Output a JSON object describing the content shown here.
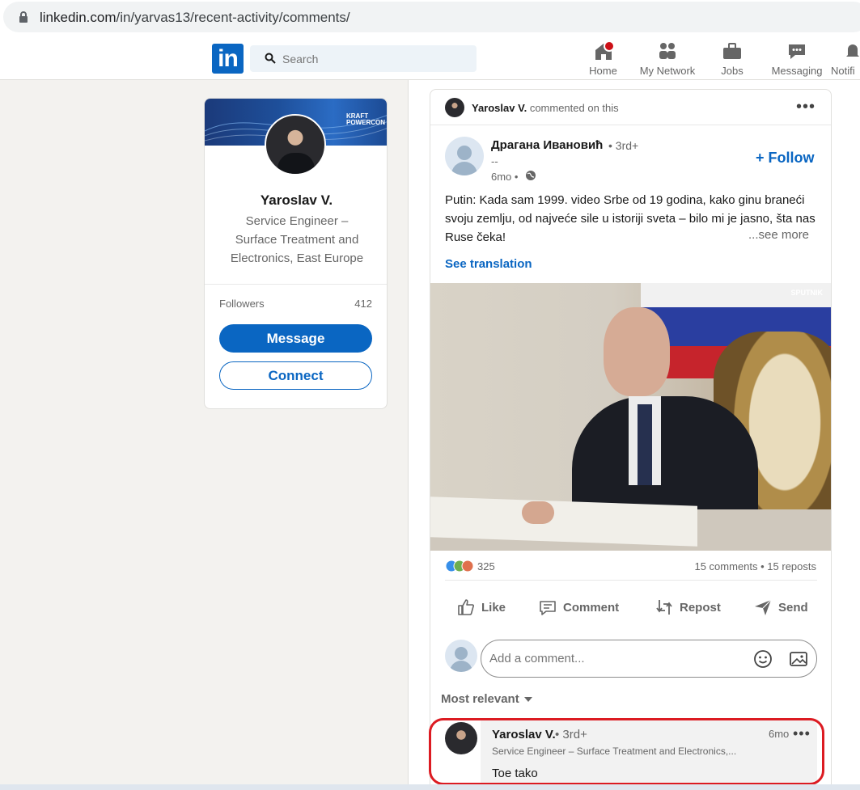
{
  "browser": {
    "url_host": "linkedin.com",
    "url_path": "/in/yarvas13/recent-activity/comments/"
  },
  "nav": {
    "logo": "in",
    "search_placeholder": "Search",
    "items": [
      {
        "label": "Home",
        "icon": "home-icon"
      },
      {
        "label": "My Network",
        "icon": "network-icon"
      },
      {
        "label": "Jobs",
        "icon": "briefcase-icon"
      },
      {
        "label": "Messaging",
        "icon": "messaging-icon"
      },
      {
        "label": "Notifi",
        "icon": "bell-icon"
      }
    ]
  },
  "profile": {
    "banner_brand": "KRAFT POWERCON",
    "name": "Yaroslav V.",
    "title": "Service Engineer – Surface Treatment and Electronics, East Europe",
    "followers_label": "Followers",
    "followers_count": "412",
    "message_label": "Message",
    "connect_label": "Connect"
  },
  "post": {
    "activity_actor": "Yaroslav V.",
    "activity_text": "commented on this",
    "author_name": "Драгана Ивановић",
    "author_degree": "• 3rd+",
    "author_sub": "--",
    "time": "6mo •",
    "follow_label": "+ Follow",
    "text": "Putin: Kada sam 1999. video Srbe od 19 godina, kako ginu braneći svoju zemlju, od najveće sile u istoriji sveta – bilo mi je jasno, šta nas Ruse čeka!",
    "see_more": "...see more",
    "see_translation": "See translation",
    "image_watermark": "SPUTNIK",
    "reactions_count": "325",
    "stats": "15 comments • 15 reposts",
    "actions": {
      "like": "Like",
      "comment": "Comment",
      "repost": "Repost",
      "send": "Send"
    },
    "comment_placeholder": "Add a comment...",
    "sort_label": "Most relevant"
  },
  "comment": {
    "name": "Yaroslav V.",
    "degree": "• 3rd+",
    "headline": "Service Engineer – Surface Treatment and Electronics,...",
    "time": "6mo",
    "text": "Toe tako"
  },
  "colors": {
    "brand_blue": "#0a66c2",
    "highlight_red": "#dc1b22",
    "badge_red": "#cc1016"
  }
}
